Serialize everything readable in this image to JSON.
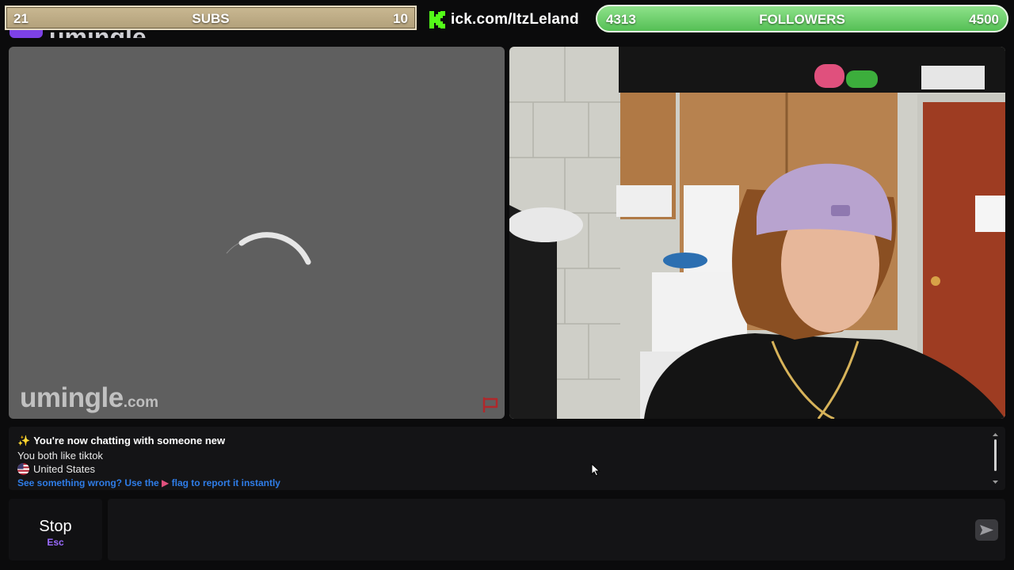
{
  "overlay": {
    "subs_bar": {
      "left_value": "21",
      "label": "SUBS",
      "right_value": "10"
    },
    "kick": {
      "url_text": "ick.com/ItzLeland",
      "brand_color": "#53fc18"
    },
    "followers_bar": {
      "left_value": "4313",
      "label": "FOLLOWERS",
      "right_value": "4500",
      "progress": 0.96
    }
  },
  "site": {
    "logo_text": "umingle",
    "watermark_main": "umingle",
    "watermark_suffix": ".com",
    "accent_color": "#7d41e6"
  },
  "stranger_video": {
    "status": "loading",
    "report_icon": "flag-outline-icon"
  },
  "self_video": {
    "description_icon": "webcam-feed"
  },
  "chat_log": {
    "line1": "You're now chatting with someone new",
    "line2": "You both like tiktok",
    "line3": "United States",
    "line4_a": "See something wrong? Use the",
    "line4_b": "flag to report it instantly"
  },
  "controls": {
    "stop_label": "Stop",
    "stop_key": "Esc",
    "message_placeholder": "",
    "send_icon": "send-arrow-icon"
  }
}
